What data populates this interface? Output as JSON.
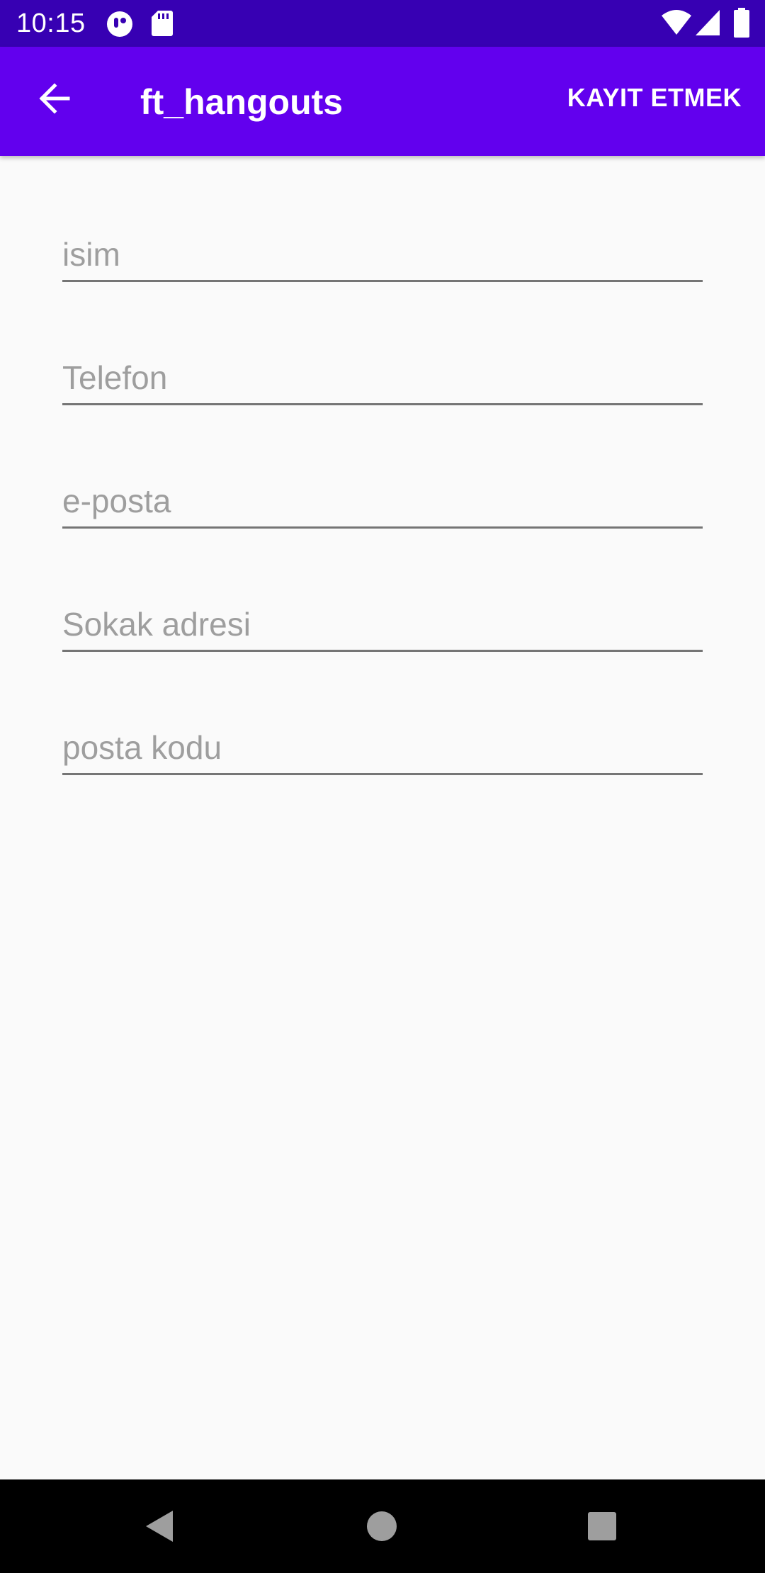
{
  "status_bar": {
    "time": "10:15",
    "icons": [
      "notification-app-icon",
      "sd-card-icon",
      "wifi-icon",
      "cellular-signal-icon",
      "battery-icon"
    ]
  },
  "app_bar": {
    "title": "ft_hangouts",
    "back_icon": "arrow-back-icon",
    "action_label": "KAYIT ETMEK"
  },
  "form": {
    "fields": [
      {
        "placeholder": "isim",
        "value": ""
      },
      {
        "placeholder": "Telefon",
        "value": ""
      },
      {
        "placeholder": "e-posta",
        "value": ""
      },
      {
        "placeholder": "Sokak adresi",
        "value": ""
      },
      {
        "placeholder": "posta kodu",
        "value": ""
      }
    ]
  },
  "nav_bar": {
    "icons": [
      "nav-back-icon",
      "nav-home-icon",
      "nav-recents-icon"
    ]
  },
  "colors": {
    "status_bar": "#3700b3",
    "app_bar": "#6200ee",
    "background": "#fafafa",
    "placeholder_text": "#9e9e9e",
    "field_underline": "#757575",
    "nav_bar": "#000000"
  }
}
